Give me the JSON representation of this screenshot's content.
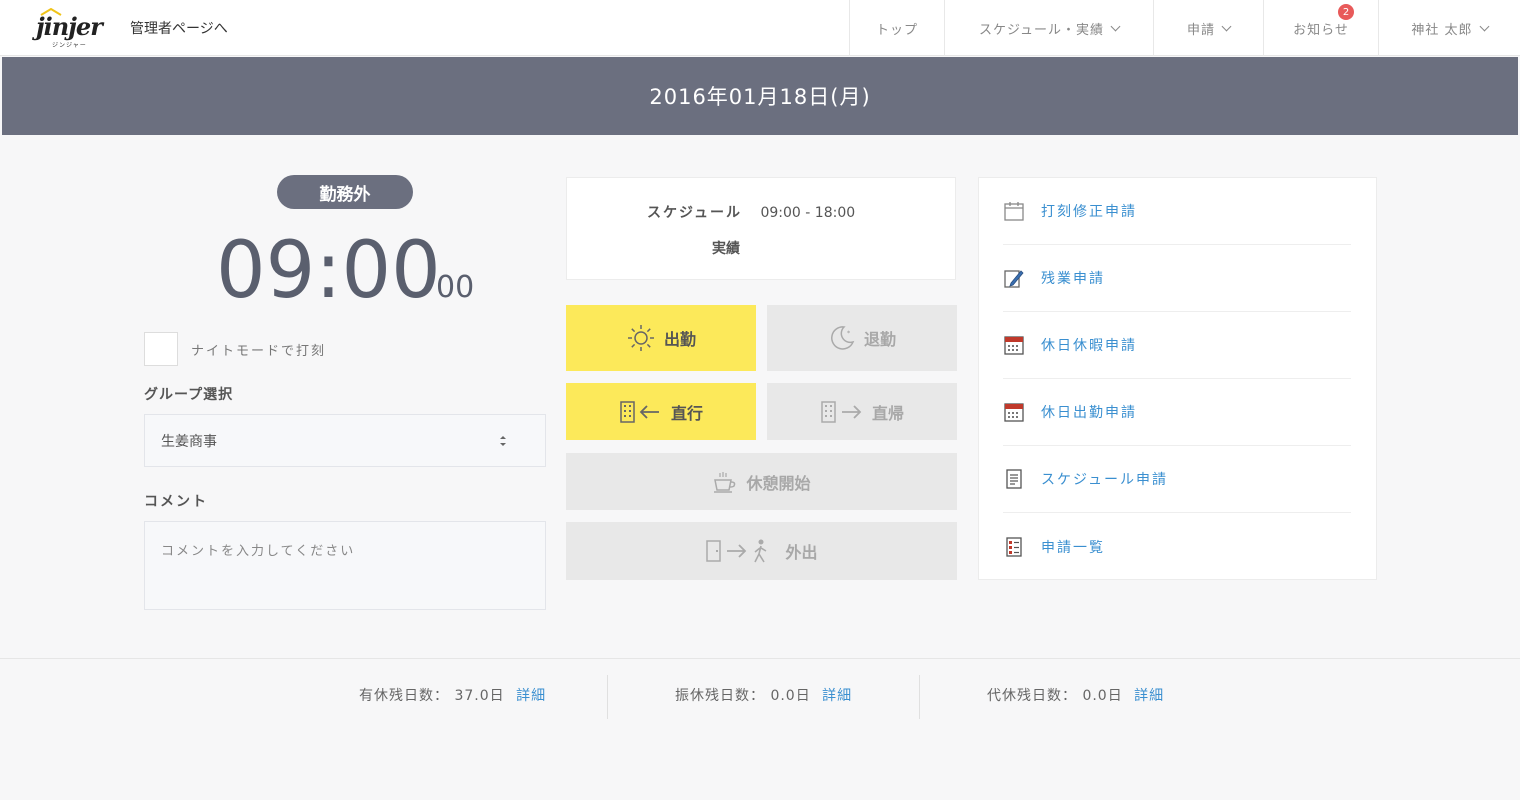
{
  "header": {
    "logo_text": "jinjer",
    "logo_sub": "ジンジャー",
    "admin_link": "管理者ページへ",
    "nav": [
      {
        "label": "トップ",
        "has_chevron": false
      },
      {
        "label": "スケジュール・実績",
        "has_chevron": true
      },
      {
        "label": "申請",
        "has_chevron": true
      },
      {
        "label": "お知らせ",
        "has_chevron": false,
        "badge": "2"
      },
      {
        "label": "神社 太郎",
        "has_chevron": true
      }
    ]
  },
  "date_banner": "2016年01月18日(月)",
  "punch": {
    "status": "勤務外",
    "time": "09:00",
    "seconds": "00",
    "night_mode_label": "ナイトモードで打刻",
    "group_label": "グループ選択",
    "group_value": "生姜商事",
    "comment_label": "コメント",
    "comment_placeholder": "コメントを入力してください"
  },
  "schedule": {
    "schedule_label": "スケジュール",
    "schedule_time": "09:00 - 18:00",
    "actual_label": "実績"
  },
  "buttons": {
    "clock_in": "出勤",
    "clock_out": "退勤",
    "direct_go": "直行",
    "direct_return": "直帰",
    "break_start": "休憩開始",
    "go_out": "外出"
  },
  "applications": [
    {
      "label": "打刻修正申請",
      "icon": "calendar-blank-icon"
    },
    {
      "label": "残業申請",
      "icon": "pencil-note-icon"
    },
    {
      "label": "休日休暇申請",
      "icon": "calendar-red-icon"
    },
    {
      "label": "休日出勤申請",
      "icon": "calendar-red-icon"
    },
    {
      "label": "スケジュール申請",
      "icon": "document-icon"
    },
    {
      "label": "申請一覧",
      "icon": "checklist-icon"
    }
  ],
  "leave_balances": [
    {
      "label": "有休残日数：",
      "value": "37.0日",
      "link": "詳細"
    },
    {
      "label": "振休残日数：",
      "value": "0.0日",
      "link": "詳細"
    },
    {
      "label": "代休残日数：",
      "value": "0.0日",
      "link": "詳細"
    }
  ],
  "colors": {
    "banner": "#6b6f7f",
    "yellow_button": "#fce95a",
    "gray_button": "#e8e8e8",
    "link": "#3a8fd0",
    "badge": "#e85a5a"
  }
}
